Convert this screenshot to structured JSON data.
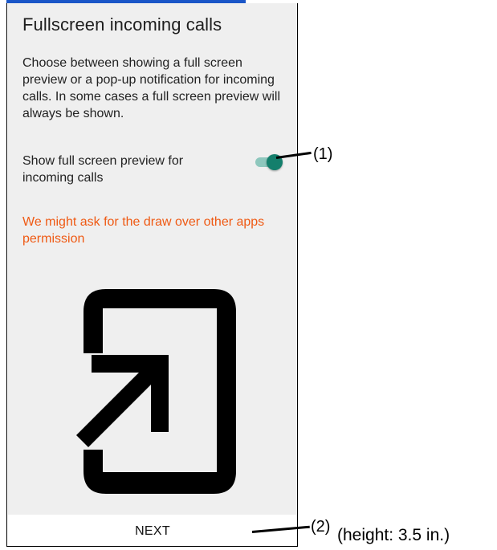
{
  "screen": {
    "title": "Fullscreen incoming calls",
    "description": "Choose between showing a full screen preview or a pop-up notification for incoming calls. In some cases a full screen preview will always be shown.",
    "toggle": {
      "label": "Show full screen preview for incoming calls",
      "checked": true,
      "accent": "#147f6c"
    },
    "warning": "We might ask for the draw over other apps permission",
    "warning_color": "#ef5a14",
    "illustration_icon": "phone-enter-arrow-icon",
    "next_label": "NEXT"
  },
  "annotations": {
    "toggle_marker": "(1)",
    "next_marker": "(2)",
    "height_note": "(height: 3.5 in.)"
  }
}
